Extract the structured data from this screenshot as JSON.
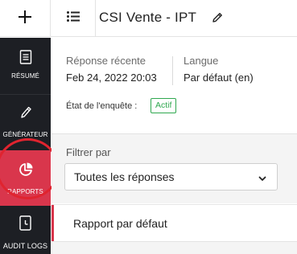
{
  "header": {
    "new_label": "+",
    "survey_title": "CSI Vente - IPT"
  },
  "sidebar": {
    "items": [
      {
        "label": "RÉSUMÉ",
        "icon": "document-icon"
      },
      {
        "label": "GÉNÉRATEUR",
        "icon": "pencil-icon"
      },
      {
        "label": "RAPPORTS",
        "icon": "pie-chart-icon",
        "active": true
      },
      {
        "label": "AUDIT LOGS",
        "icon": "file-clock-icon"
      }
    ],
    "active_color": "#d9364c",
    "background": "#1d1f24"
  },
  "summary": {
    "recent_response_label": "Réponse récente",
    "recent_response_value": "Feb 24, 2022 20:03",
    "language_label": "Langue",
    "language_value": "Par défaut (en)",
    "survey_status_label": "État de l'enquête :",
    "survey_status_value": "Actif",
    "status_color": "#2fa84f"
  },
  "filter": {
    "label": "Filtrer par",
    "selected": "Toutes les réponses"
  },
  "reports": {
    "items": [
      {
        "label": "Rapport par défaut"
      }
    ]
  }
}
